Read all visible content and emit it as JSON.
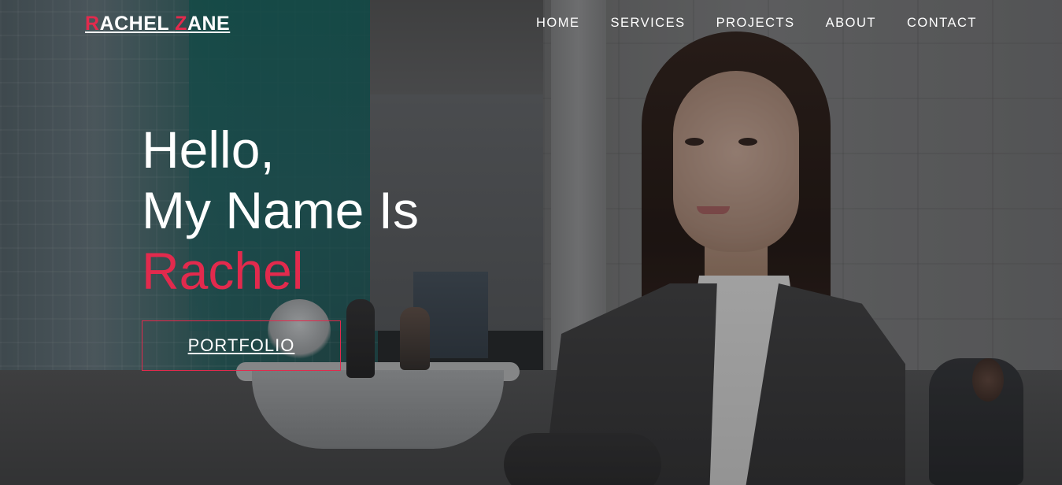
{
  "brand": {
    "logo_first_initial": "R",
    "logo_first_rest": "ACHEL ",
    "logo_last_initial": "Z",
    "logo_last_rest": "ANE",
    "accent_color": "#e22a4d"
  },
  "nav": {
    "items": [
      "HOME",
      "SERVICES",
      "PROJECTS",
      "ABOUT",
      "CONTACT"
    ]
  },
  "hero": {
    "line1": "Hello,",
    "line2": "My Name Is",
    "name": "Rachel",
    "button_label": "PORTFOLIO"
  }
}
